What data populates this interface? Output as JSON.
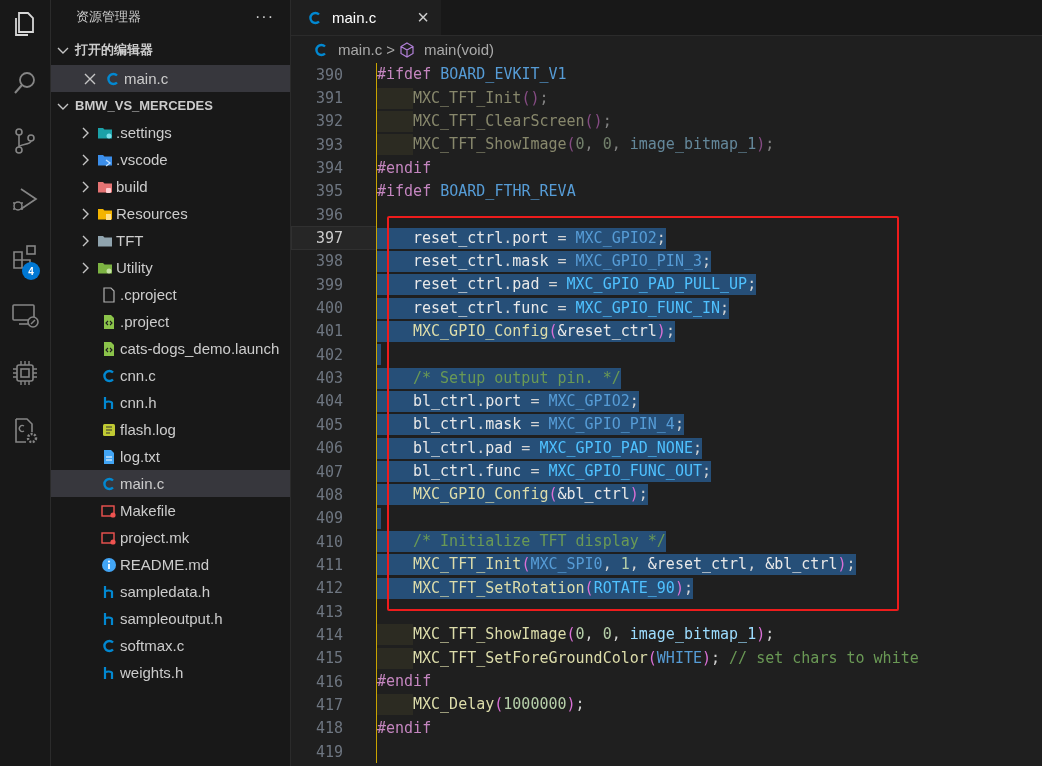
{
  "activity_bar": [
    {
      "kind": "explorer",
      "selected": true
    },
    {
      "kind": "search",
      "selected": false
    },
    {
      "kind": "source-control",
      "selected": false
    },
    {
      "kind": "run-debug",
      "selected": false
    },
    {
      "kind": "extensions",
      "selected": false,
      "badge": "4"
    },
    {
      "kind": "remote",
      "selected": false
    },
    {
      "kind": "chip",
      "selected": false
    },
    {
      "kind": "cpp-config",
      "selected": false
    }
  ],
  "sidebar": {
    "title": "资源管理器",
    "more": "···",
    "sections": [
      {
        "title": "打开的编辑器",
        "expanded": true,
        "kind": "open-editors",
        "items": [
          {
            "label": "main.c",
            "kind": "c",
            "selected": true
          }
        ]
      },
      {
        "title": "BMW_VS_MERCEDES",
        "expanded": true,
        "kind": "folder",
        "items": [
          {
            "label": ".settings",
            "kind": "folder-settings",
            "expanded": false,
            "selected": false
          },
          {
            "label": ".vscode",
            "kind": "folder-vscode",
            "expanded": false,
            "selected": false
          },
          {
            "label": "build",
            "kind": "folder-build",
            "expanded": false,
            "selected": false
          },
          {
            "label": "Resources",
            "kind": "folder-resources",
            "expanded": false,
            "selected": false
          },
          {
            "label": "TFT",
            "kind": "folder",
            "expanded": false,
            "selected": false
          },
          {
            "label": "Utility",
            "kind": "folder-utility",
            "expanded": false,
            "selected": false
          },
          {
            "label": ".cproject",
            "kind": "file",
            "selected": false
          },
          {
            "label": ".project",
            "kind": "xml",
            "selected": false
          },
          {
            "label": "cats-dogs_demo.launch",
            "kind": "xml",
            "selected": false
          },
          {
            "label": "cnn.c",
            "kind": "c",
            "selected": false
          },
          {
            "label": "cnn.h",
            "kind": "h",
            "selected": false
          },
          {
            "label": "flash.log",
            "kind": "log",
            "selected": false
          },
          {
            "label": "log.txt",
            "kind": "txt",
            "selected": false
          },
          {
            "label": "main.c",
            "kind": "c",
            "selected": true
          },
          {
            "label": "Makefile",
            "kind": "make",
            "selected": false
          },
          {
            "label": "project.mk",
            "kind": "make",
            "selected": false
          },
          {
            "label": "README.md",
            "kind": "info",
            "selected": false
          },
          {
            "label": "sampledata.h",
            "kind": "h",
            "selected": false
          },
          {
            "label": "sampleoutput.h",
            "kind": "h",
            "selected": false
          },
          {
            "label": "softmax.c",
            "kind": "c",
            "selected": false
          },
          {
            "label": "weights.h",
            "kind": "h",
            "selected": false
          }
        ]
      }
    ]
  },
  "tabs": [
    {
      "label": "main.c",
      "kind": "c",
      "selected": true,
      "close": "×"
    }
  ],
  "breadcrumbs": [
    {
      "label": "main.c",
      "kind": "c"
    },
    {
      "label": "main(void)",
      "kind": "symbol"
    }
  ],
  "breadcrumb_separator": ">",
  "editor": {
    "blocks": [
      {
        "boxed": false,
        "lines": [
          {
            "number": "390",
            "selected": false,
            "current": false,
            "inactive": false,
            "indented": false,
            "tokens": [
              {
                "text": "#ifdef",
                "kind": "kw"
              },
              {
                "text": " BOARD_EVKIT_V1",
                "kind": "macro"
              }
            ]
          },
          {
            "number": "391",
            "selected": false,
            "current": false,
            "inactive": true,
            "indented": true,
            "tokens": [
              {
                "text": "MXC_TFT_Init",
                "kind": "fn"
              },
              {
                "text": "()",
                "kind": "paren"
              },
              {
                "text": ";",
                "kind": "punc"
              }
            ]
          },
          {
            "number": "392",
            "selected": false,
            "current": false,
            "inactive": true,
            "indented": true,
            "tokens": [
              {
                "text": "MXC_TFT_ClearScreen",
                "kind": "fn"
              },
              {
                "text": "()",
                "kind": "paren"
              },
              {
                "text": ";",
                "kind": "punc"
              }
            ]
          },
          {
            "number": "393",
            "selected": false,
            "current": false,
            "inactive": true,
            "indented": true,
            "tokens": [
              {
                "text": "MXC_TFT_ShowImage",
                "kind": "fn"
              },
              {
                "text": "(",
                "kind": "paren"
              },
              {
                "text": "0",
                "kind": "num"
              },
              {
                "text": ", ",
                "kind": "punc"
              },
              {
                "text": "0",
                "kind": "num"
              },
              {
                "text": ", ",
                "kind": "punc"
              },
              {
                "text": "image_bitmap_1",
                "kind": "var"
              },
              {
                "text": ")",
                "kind": "paren"
              },
              {
                "text": ";",
                "kind": "punc"
              }
            ]
          },
          {
            "number": "394",
            "selected": false,
            "current": false,
            "inactive": false,
            "indented": false,
            "tokens": [
              {
                "text": "#endif",
                "kind": "kw"
              }
            ]
          },
          {
            "number": "395",
            "selected": false,
            "current": false,
            "inactive": false,
            "indented": false,
            "tokens": [
              {
                "text": "#ifdef",
                "kind": "kw"
              },
              {
                "text": " BOARD_FTHR_REVA",
                "kind": "macro"
              }
            ]
          },
          {
            "number": "396",
            "selected": false,
            "current": false,
            "indented": false
          }
        ]
      },
      {
        "boxed": true,
        "lines": [
          {
            "number": "397",
            "selected": true,
            "current": true,
            "inactive": false,
            "indented": true,
            "tokens": [
              {
                "text": "reset_ctrl",
                "kind": "var"
              },
              {
                "text": ".",
                "kind": "punc"
              },
              {
                "text": "port",
                "kind": "var"
              },
              {
                "text": " = ",
                "kind": "punc"
              },
              {
                "text": "MXC_GPIO2",
                "kind": "macro"
              },
              {
                "text": ";",
                "kind": "punc"
              }
            ]
          },
          {
            "number": "398",
            "selected": true,
            "current": false,
            "inactive": false,
            "indented": true,
            "tokens": [
              {
                "text": "reset_ctrl",
                "kind": "var"
              },
              {
                "text": ".",
                "kind": "punc"
              },
              {
                "text": "mask",
                "kind": "var"
              },
              {
                "text": " = ",
                "kind": "punc"
              },
              {
                "text": "MXC_GPIO_PIN_3",
                "kind": "macro"
              },
              {
                "text": ";",
                "kind": "punc"
              }
            ]
          },
          {
            "number": "399",
            "selected": true,
            "current": false,
            "inactive": false,
            "indented": true,
            "tokens": [
              {
                "text": "reset_ctrl",
                "kind": "var"
              },
              {
                "text": ".",
                "kind": "punc"
              },
              {
                "text": "pad",
                "kind": "var"
              },
              {
                "text": " = ",
                "kind": "punc"
              },
              {
                "text": "MXC_GPIO_PAD_PULL_UP",
                "kind": "enum"
              },
              {
                "text": ";",
                "kind": "punc"
              }
            ]
          },
          {
            "number": "400",
            "selected": true,
            "current": false,
            "inactive": false,
            "indented": true,
            "tokens": [
              {
                "text": "reset_ctrl",
                "kind": "var"
              },
              {
                "text": ".",
                "kind": "punc"
              },
              {
                "text": "func",
                "kind": "var"
              },
              {
                "text": " = ",
                "kind": "punc"
              },
              {
                "text": "MXC_GPIO_FUNC_IN",
                "kind": "enum"
              },
              {
                "text": ";",
                "kind": "punc"
              }
            ]
          },
          {
            "number": "401",
            "selected": true,
            "current": false,
            "inactive": false,
            "indented": true,
            "tokens": [
              {
                "text": "MXC_GPIO_Config",
                "kind": "fn"
              },
              {
                "text": "(",
                "kind": "paren"
              },
              {
                "text": "&reset_ctrl",
                "kind": "var"
              },
              {
                "text": ")",
                "kind": "paren"
              },
              {
                "text": ";",
                "kind": "punc"
              }
            ]
          },
          {
            "number": "402",
            "selected": true,
            "current": false,
            "indented": false
          },
          {
            "number": "403",
            "selected": true,
            "current": false,
            "inactive": false,
            "indented": true,
            "tokens": [
              {
                "text": "/* Setup output pin. */",
                "kind": "cmt"
              }
            ]
          },
          {
            "number": "404",
            "selected": true,
            "current": false,
            "inactive": false,
            "indented": true,
            "tokens": [
              {
                "text": "bl_ctrl",
                "kind": "var"
              },
              {
                "text": ".",
                "kind": "punc"
              },
              {
                "text": "port",
                "kind": "var"
              },
              {
                "text": " = ",
                "kind": "punc"
              },
              {
                "text": "MXC_GPIO2",
                "kind": "macro"
              },
              {
                "text": ";",
                "kind": "punc"
              }
            ]
          },
          {
            "number": "405",
            "selected": true,
            "current": false,
            "inactive": false,
            "indented": true,
            "tokens": [
              {
                "text": "bl_ctrl",
                "kind": "var"
              },
              {
                "text": ".",
                "kind": "punc"
              },
              {
                "text": "mask",
                "kind": "var"
              },
              {
                "text": " = ",
                "kind": "punc"
              },
              {
                "text": "MXC_GPIO_PIN_4",
                "kind": "macro"
              },
              {
                "text": ";",
                "kind": "punc"
              }
            ]
          },
          {
            "number": "406",
            "selected": true,
            "current": false,
            "inactive": false,
            "indented": true,
            "tokens": [
              {
                "text": "bl_ctrl",
                "kind": "var"
              },
              {
                "text": ".",
                "kind": "punc"
              },
              {
                "text": "pad",
                "kind": "var"
              },
              {
                "text": " = ",
                "kind": "punc"
              },
              {
                "text": "MXC_GPIO_PAD_NONE",
                "kind": "enum"
              },
              {
                "text": ";",
                "kind": "punc"
              }
            ]
          },
          {
            "number": "407",
            "selected": true,
            "current": false,
            "inactive": false,
            "indented": true,
            "tokens": [
              {
                "text": "bl_ctrl",
                "kind": "var"
              },
              {
                "text": ".",
                "kind": "punc"
              },
              {
                "text": "func",
                "kind": "var"
              },
              {
                "text": " = ",
                "kind": "punc"
              },
              {
                "text": "MXC_GPIO_FUNC_OUT",
                "kind": "enum"
              },
              {
                "text": ";",
                "kind": "punc"
              }
            ]
          },
          {
            "number": "408",
            "selected": true,
            "current": false,
            "inactive": false,
            "indented": true,
            "tokens": [
              {
                "text": "MXC_GPIO_Config",
                "kind": "fn"
              },
              {
                "text": "(",
                "kind": "paren"
              },
              {
                "text": "&bl_ctrl",
                "kind": "var"
              },
              {
                "text": ")",
                "kind": "paren"
              },
              {
                "text": ";",
                "kind": "punc"
              }
            ]
          },
          {
            "number": "409",
            "selected": true,
            "current": false,
            "indented": false
          },
          {
            "number": "410",
            "selected": true,
            "current": false,
            "inactive": false,
            "indented": true,
            "tokens": [
              {
                "text": "/* Initialize TFT display */",
                "kind": "cmt"
              }
            ]
          },
          {
            "number": "411",
            "selected": true,
            "current": false,
            "inactive": false,
            "indented": true,
            "tokens": [
              {
                "text": "MXC_TFT_Init",
                "kind": "fn"
              },
              {
                "text": "(",
                "kind": "paren"
              },
              {
                "text": "MXC_SPI0",
                "kind": "macro"
              },
              {
                "text": ", ",
                "kind": "punc"
              },
              {
                "text": "1",
                "kind": "num"
              },
              {
                "text": ", ",
                "kind": "punc"
              },
              {
                "text": "&reset_ctrl",
                "kind": "var"
              },
              {
                "text": ", ",
                "kind": "punc"
              },
              {
                "text": "&bl_ctrl",
                "kind": "var"
              },
              {
                "text": ")",
                "kind": "paren"
              },
              {
                "text": ";",
                "kind": "punc"
              }
            ]
          },
          {
            "number": "412",
            "selected": true,
            "current": false,
            "inactive": false,
            "indented": true,
            "tokens": [
              {
                "text": "MXC_TFT_SetRotation",
                "kind": "fn"
              },
              {
                "text": "(",
                "kind": "paren"
              },
              {
                "text": "ROTATE_90",
                "kind": "enum"
              },
              {
                "text": ")",
                "kind": "paren"
              },
              {
                "text": ";",
                "kind": "punc"
              }
            ]
          }
        ]
      },
      {
        "boxed": false,
        "lines": [
          {
            "number": "413",
            "selected": false,
            "current": false,
            "indented": false
          },
          {
            "number": "414",
            "selected": false,
            "current": false,
            "inactive": false,
            "indented": true,
            "tokens": [
              {
                "text": "MXC_TFT_ShowImage",
                "kind": "fn"
              },
              {
                "text": "(",
                "kind": "paren"
              },
              {
                "text": "0",
                "kind": "num"
              },
              {
                "text": ", ",
                "kind": "punc"
              },
              {
                "text": "0",
                "kind": "num"
              },
              {
                "text": ", ",
                "kind": "punc"
              },
              {
                "text": "image_bitmap_1",
                "kind": "var"
              },
              {
                "text": ")",
                "kind": "paren"
              },
              {
                "text": ";",
                "kind": "punc"
              }
            ]
          },
          {
            "number": "415",
            "selected": false,
            "current": false,
            "inactive": false,
            "indented": true,
            "tokens": [
              {
                "text": "MXC_TFT_SetForeGroundColor",
                "kind": "fn"
              },
              {
                "text": "(",
                "kind": "paren"
              },
              {
                "text": "WHITE",
                "kind": "macro"
              },
              {
                "text": ")",
                "kind": "paren"
              },
              {
                "text": "; ",
                "kind": "punc"
              },
              {
                "text": "// set chars to white",
                "kind": "cmt"
              }
            ]
          },
          {
            "number": "416",
            "selected": false,
            "current": false,
            "inactive": false,
            "indented": false,
            "tokens": [
              {
                "text": "#endif",
                "kind": "kw"
              }
            ]
          },
          {
            "number": "417",
            "selected": false,
            "current": false,
            "inactive": false,
            "indented": true,
            "tokens": [
              {
                "text": "MXC_Delay",
                "kind": "fn"
              },
              {
                "text": "(",
                "kind": "paren"
              },
              {
                "text": "1000000",
                "kind": "num"
              },
              {
                "text": ")",
                "kind": "paren"
              },
              {
                "text": ";",
                "kind": "punc"
              }
            ]
          },
          {
            "number": "418",
            "selected": false,
            "current": false,
            "inactive": false,
            "indented": false,
            "tokens": [
              {
                "text": "#endif",
                "kind": "kw"
              }
            ]
          },
          {
            "number": "419",
            "selected": false,
            "current": false,
            "indented": false
          }
        ]
      }
    ]
  }
}
